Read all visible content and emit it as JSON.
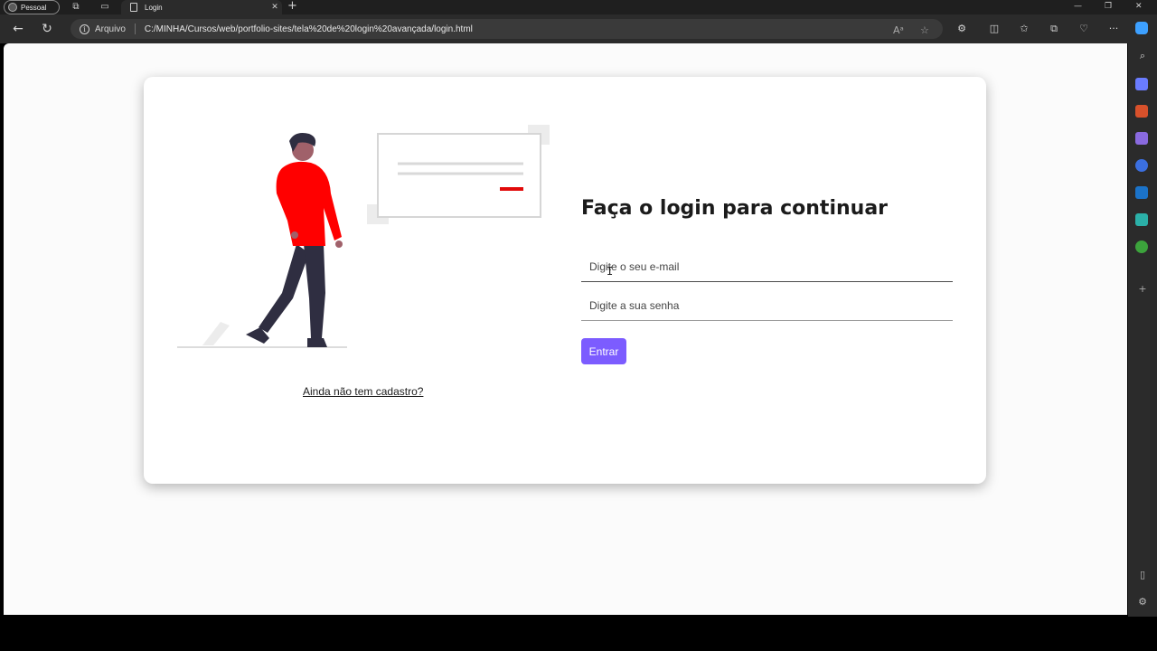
{
  "browser": {
    "profile_label": "Pessoal",
    "tab_title": "Login",
    "close_tab": "✕",
    "new_tab": "+",
    "window_controls": [
      "—",
      "❐",
      "✕"
    ],
    "address_label": "Arquivo",
    "url": "C:/MINHA/Cursos/web/portfolio-sites/tela%20de%20login%20avançada/login.html",
    "read_aloud": "A⁠ᵃ",
    "more": "···"
  },
  "page": {
    "title": "Faça o login para continuar",
    "email_placeholder": "Digite o seu e-mail",
    "password_placeholder": "Digite a sua senha",
    "submit_label": "Entrar",
    "signup_link": "Ainda não tem cadastro?"
  },
  "colors": {
    "accent": "#7c5cff",
    "shirt": "#ff0000",
    "card_line_accent": "#e10a0a"
  }
}
